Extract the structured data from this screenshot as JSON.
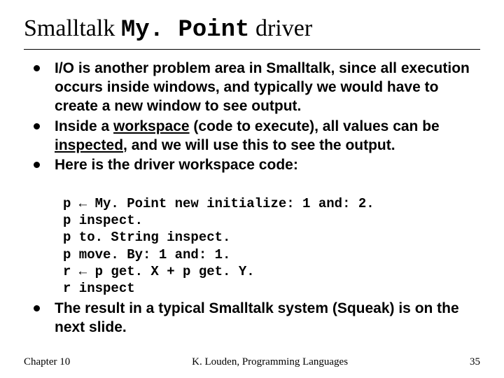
{
  "title_pre": "Smalltalk ",
  "title_mono": "My. Point",
  "title_post": " driver",
  "bullets": {
    "b1_a": "I/O is another problem area in Smalltalk, since all execution occurs inside windows, and typically we would have to create a new window to see output.",
    "b2_a": "Inside a ",
    "b2_u1": "workspace",
    "b2_b": " (code to execute), all values can be ",
    "b2_u2": "inspected",
    "b2_c": ", and we will use this to see the output.",
    "b3_a": "Here is the driver workspace code:",
    "b4_a": "The result in a typical Smalltalk system (Squeak) is on the next slide."
  },
  "code_lines": {
    "l1": "p ← My. Point new initialize: 1 and: 2.",
    "l2": "p inspect.",
    "l3": "p to. String inspect.",
    "l4": "p move. By: 1 and: 1.",
    "l5": "r ← p get. X + p get. Y.",
    "l6": "r inspect"
  },
  "footer": {
    "left": "Chapter 10",
    "center": "K. Louden, Programming Languages",
    "right": "35"
  }
}
